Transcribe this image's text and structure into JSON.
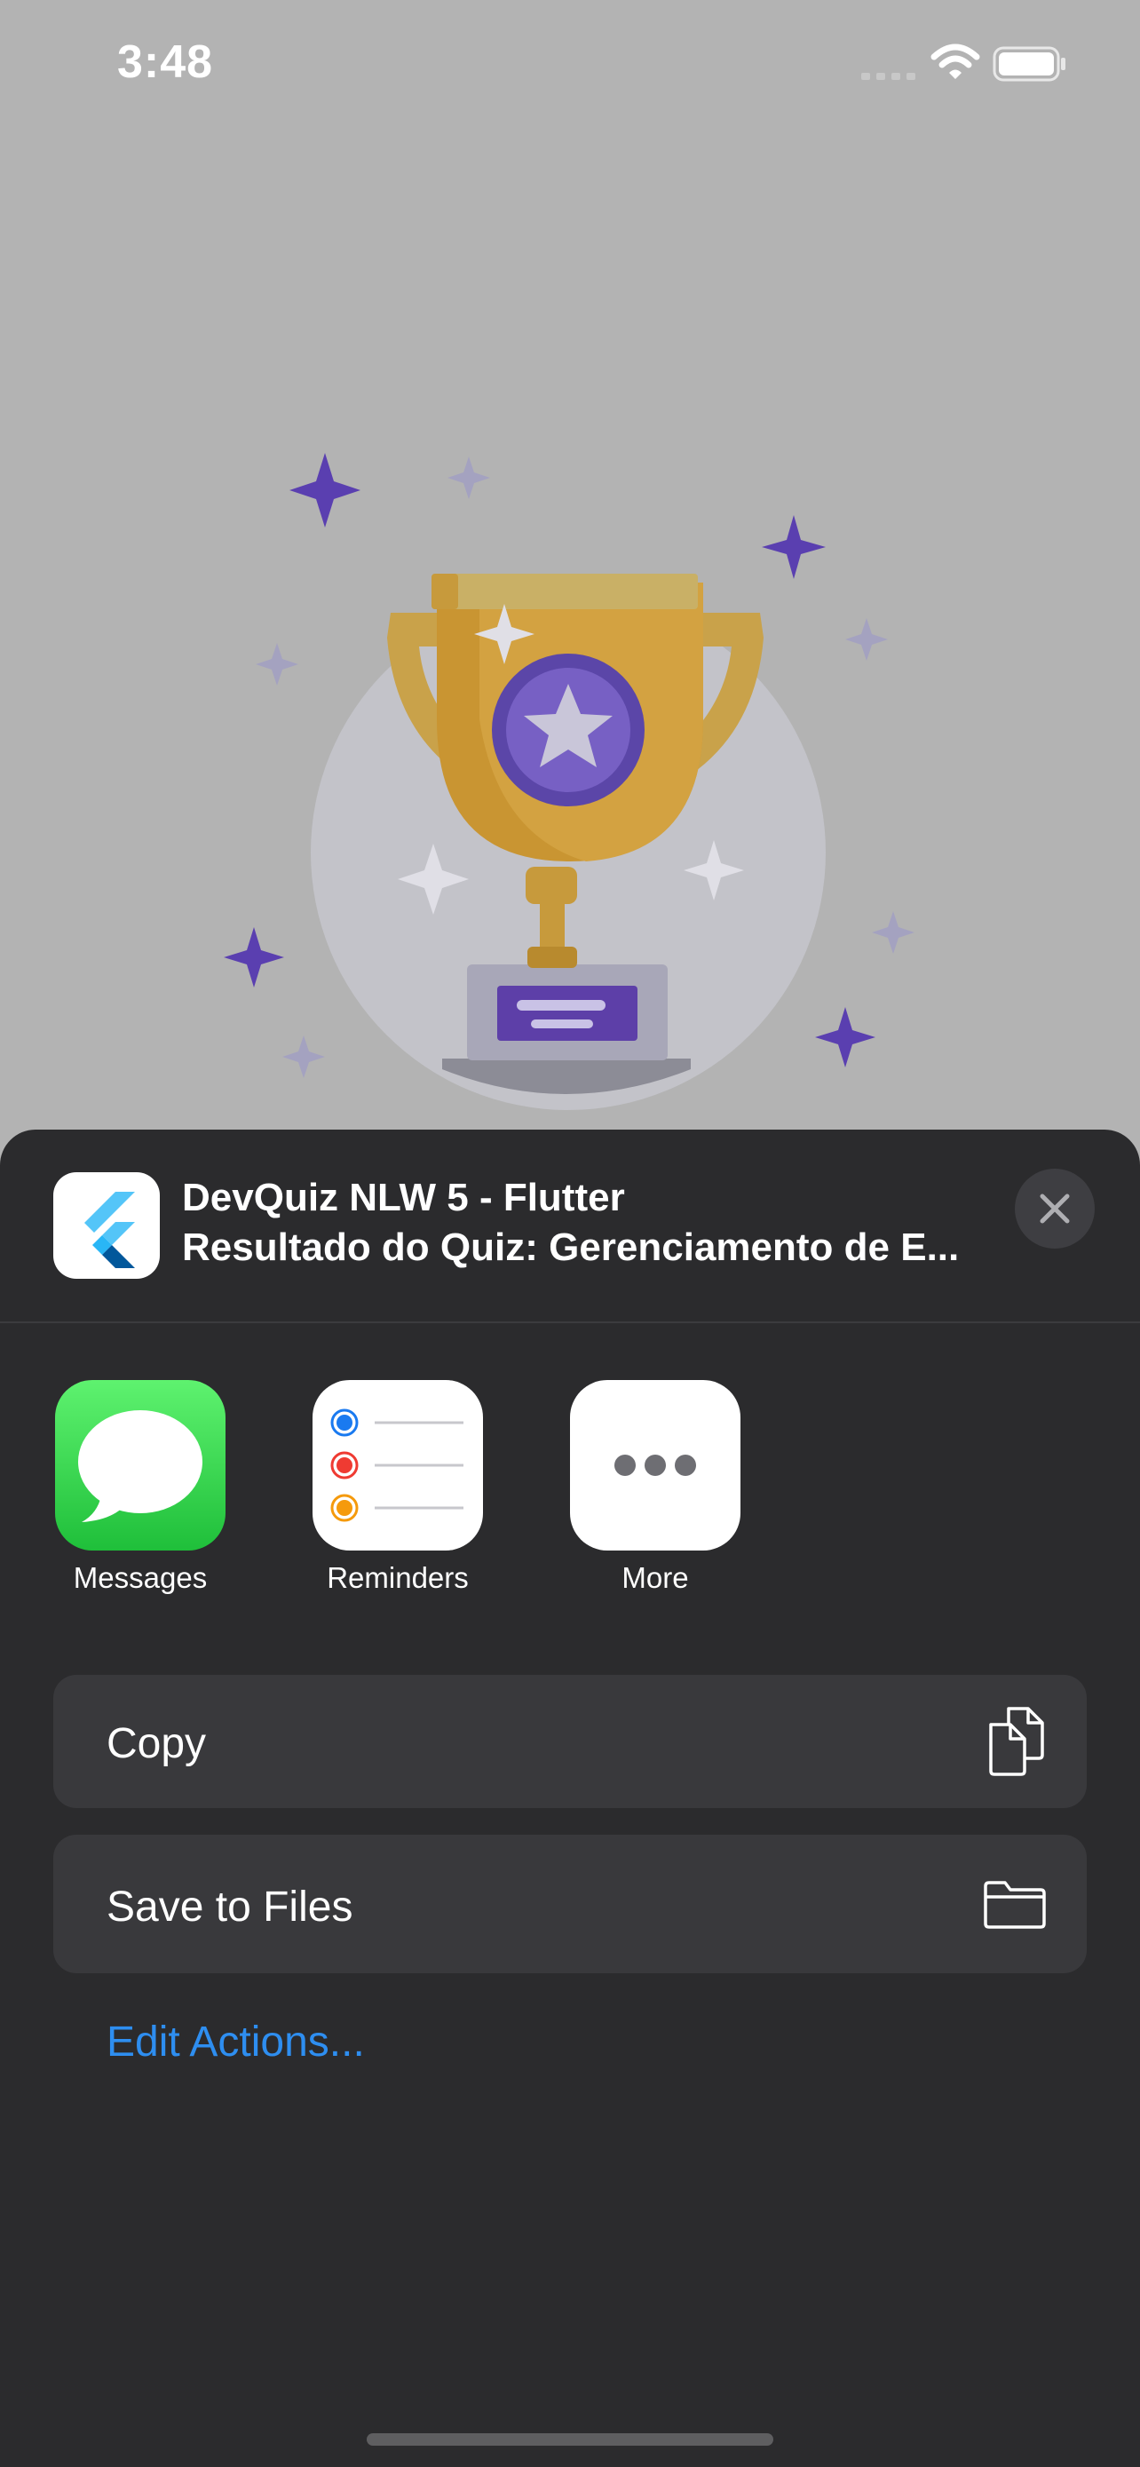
{
  "status_bar": {
    "time": "3:48",
    "signal_icon": "cellular-signal-icon",
    "wifi_icon": "wifi-icon",
    "battery_icon": "battery-icon"
  },
  "background": {
    "illustration_icon": "trophy-icon",
    "overlay_color": "#b3b3b3"
  },
  "share_sheet": {
    "app_icon": "flutter-logo-icon",
    "title": "DevQuiz NLW 5 - Flutter",
    "subtitle": "Resultado do Quiz: Gerenciamento de E...",
    "close_icon": "close-icon",
    "targets": [
      {
        "label": "Messages",
        "icon": "messages-icon"
      },
      {
        "label": "Reminders",
        "icon": "reminders-icon"
      },
      {
        "label": "More",
        "icon": "more-icon"
      }
    ],
    "actions": [
      {
        "label": "Copy",
        "icon": "copy-icon"
      },
      {
        "label": "Save to Files",
        "icon": "folder-icon"
      }
    ],
    "edit_actions": "Edit Actions...",
    "colors": {
      "sheet_background": "#2b2b2d",
      "row_background": "#39393c",
      "link": "#2e8ef0"
    }
  }
}
